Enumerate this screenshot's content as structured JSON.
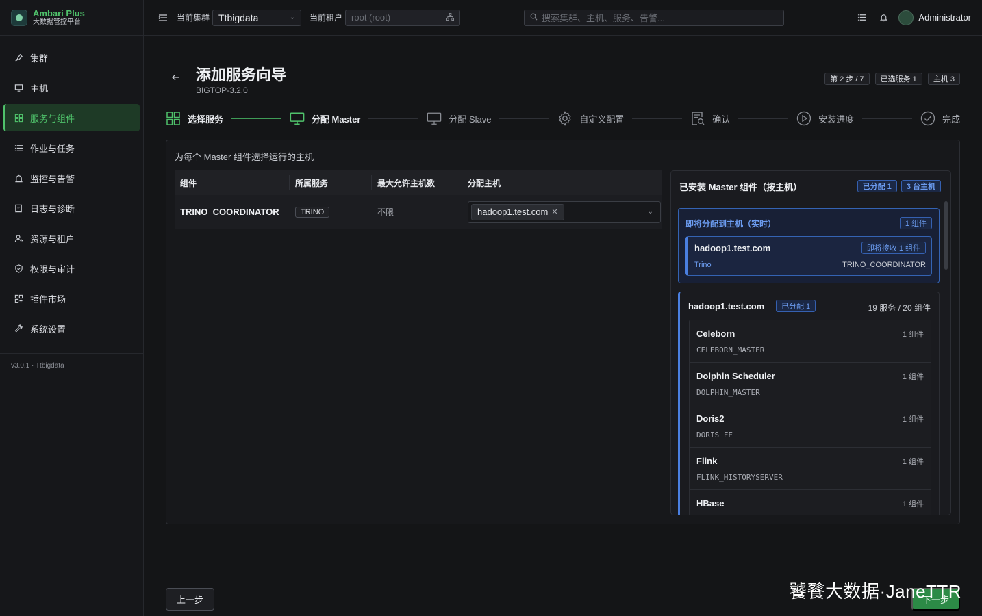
{
  "brand": {
    "name": "Ambari Plus",
    "sub": "大数据管控平台"
  },
  "sidebar": {
    "items": [
      {
        "label": "集群",
        "icon": "rocket-icon"
      },
      {
        "label": "主机",
        "icon": "monitor-icon"
      },
      {
        "label": "服务与组件",
        "icon": "grid-icon",
        "active": true
      },
      {
        "label": "作业与任务",
        "icon": "list-icon"
      },
      {
        "label": "监控与告警",
        "icon": "alarm-icon"
      },
      {
        "label": "日志与诊断",
        "icon": "log-icon"
      },
      {
        "label": "资源与租户",
        "icon": "users-icon"
      },
      {
        "label": "权限与审计",
        "icon": "shield-icon"
      },
      {
        "label": "插件市场",
        "icon": "puzzle-icon"
      },
      {
        "label": "系统设置",
        "icon": "wrench-icon"
      }
    ],
    "version": "v3.0.1 · Ttbigdata"
  },
  "header": {
    "cluster_label": "当前集群",
    "cluster_value": "Ttbigdata",
    "tenant_label": "当前租户",
    "tenant_value": "root (root)",
    "search_placeholder": "搜索集群、主机、服务、告警...",
    "user": "Administrator"
  },
  "page": {
    "title": "添加服务向导",
    "subtitle": "BIGTOP-3.2.0",
    "badges": [
      "第 2 步 / 7",
      "已选服务 1",
      "主机 3"
    ]
  },
  "steps": [
    {
      "label": "选择服务",
      "state": "done"
    },
    {
      "label": "分配 Master",
      "state": "current"
    },
    {
      "label": "分配 Slave",
      "state": "todo"
    },
    {
      "label": "自定义配置",
      "state": "todo"
    },
    {
      "label": "确认",
      "state": "todo"
    },
    {
      "label": "安装进度",
      "state": "todo"
    },
    {
      "label": "完成",
      "state": "todo"
    }
  ],
  "assign": {
    "description": "为每个 Master 组件选择运行的主机",
    "columns": [
      "组件",
      "所属服务",
      "最大允许主机数",
      "分配主机"
    ],
    "rows": [
      {
        "component": "TRINO_COORDINATOR",
        "service": "TRINO",
        "max": "不限",
        "host": "hadoop1.test.com"
      }
    ]
  },
  "installed": {
    "title": "已安装 Master 组件（按主机）",
    "tag_assigned": "已分配 1",
    "tag_hosts": "3 台主机",
    "pending": {
      "title": "即将分配到主机（实时）",
      "count": "1 组件",
      "host": "hadoop1.test.com",
      "receive": "即将接收 1 组件",
      "service": "Trino",
      "component": "TRINO_COORDINATOR"
    },
    "host_block": {
      "name": "hadoop1.test.com",
      "tag": "已分配 1",
      "summary": "19 服务 / 20 组件",
      "services": [
        {
          "name": "Celeborn",
          "count": "1 组件",
          "component": "CELEBORN_MASTER"
        },
        {
          "name": "Dolphin Scheduler",
          "count": "1 组件",
          "component": "DOLPHIN_MASTER"
        },
        {
          "name": "Doris2",
          "count": "1 组件",
          "component": "DORIS_FE"
        },
        {
          "name": "Flink",
          "count": "1 组件",
          "component": "FLINK_HISTORYSERVER"
        },
        {
          "name": "HBase",
          "count": "1 组件",
          "component": ""
        }
      ]
    }
  },
  "footer": {
    "prev": "上一步",
    "next": "下一步"
  },
  "watermark": "饕餮大数据·JaneTTR",
  "colors": {
    "accent": "#4fc26b",
    "blue": "#4a7fe0",
    "bg": "#141517"
  }
}
